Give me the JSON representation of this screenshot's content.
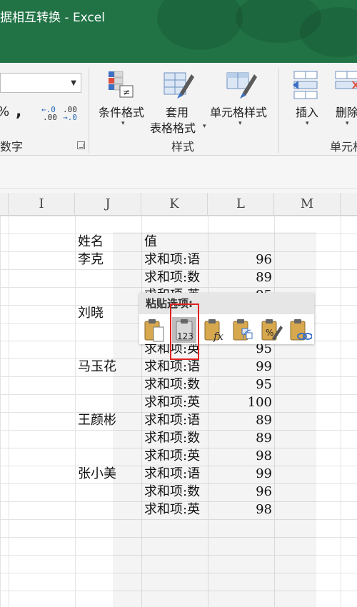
{
  "title_bar": {
    "text": "据相互转换  -  Excel"
  },
  "ribbon": {
    "number_format_value": "",
    "number_symbols": {
      "percent": "%",
      "comma": ","
    },
    "decimal_increase": {
      "top": "←.0",
      "bottom": ".00"
    },
    "decimal_decrease": {
      "top": ".00",
      "bottom": "→.0"
    },
    "groups": {
      "number": "数字",
      "styles": "样式",
      "cells": "单元格"
    },
    "buttons": {
      "conditional_format": "条件格式",
      "format_as_table_line1": "套用",
      "format_as_table_line2": "表格格式",
      "cell_styles": "单元格样式",
      "insert": "插入",
      "delete": "删除"
    },
    "caret": "▾"
  },
  "columns": [
    "I",
    "J",
    "K",
    "L",
    "M"
  ],
  "sheet": {
    "header": {
      "name": "姓名",
      "value": "值"
    },
    "rows": [
      {
        "name": "李克",
        "field": "求和项:语",
        "value": "96"
      },
      {
        "name": "",
        "field": "求和项:数",
        "value": "89"
      },
      {
        "name": "",
        "field": "求和项:英",
        "value": "95"
      },
      {
        "name": "刘晓",
        "field": "",
        "value": ""
      },
      {
        "name": "",
        "field": "",
        "value": ""
      },
      {
        "name": "",
        "field": "求和项:英",
        "value": "95"
      },
      {
        "name": "马玉花",
        "field": "求和项:语",
        "value": "99"
      },
      {
        "name": "",
        "field": "求和项:数",
        "value": "95"
      },
      {
        "name": "",
        "field": "求和项:英",
        "value": "100"
      },
      {
        "name": "王颜彬",
        "field": "求和项:语",
        "value": "89"
      },
      {
        "name": "",
        "field": "求和项:数",
        "value": "89"
      },
      {
        "name": "",
        "field": "求和项:英",
        "value": "98"
      },
      {
        "name": "张小美",
        "field": "求和项:语",
        "value": "99"
      },
      {
        "name": "",
        "field": "求和项:数",
        "value": "96"
      },
      {
        "name": "",
        "field": "求和项:英",
        "value": "98"
      }
    ]
  },
  "paste_options": {
    "title": "粘贴选项:",
    "values_label": "123",
    "icons": [
      "paste-icon",
      "paste-values-icon",
      "paste-formulas-icon",
      "paste-transpose-icon",
      "paste-formatting-icon",
      "paste-link-icon"
    ],
    "selected": "paste-values-icon"
  },
  "colors": {
    "title_bar": "#217346",
    "highlight": "#e02020"
  }
}
